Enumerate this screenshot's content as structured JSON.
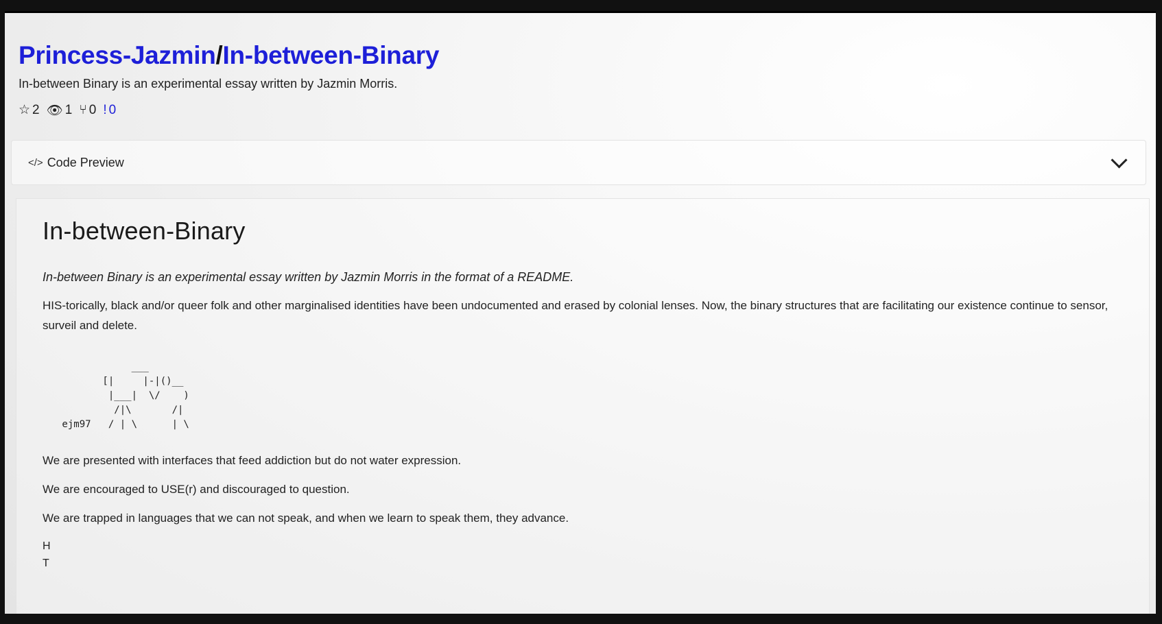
{
  "repo": {
    "owner": "Princess-Jazmin",
    "separator": "/",
    "name": "In-between-Binary",
    "description": "In-between Binary is an experimental essay written by Jazmin Morris."
  },
  "stats": {
    "stars": "2",
    "watchers": "1",
    "forks": "0",
    "issues": "0"
  },
  "code_preview": {
    "icon": "</>",
    "label": "Code Preview"
  },
  "readme": {
    "title": "In-between-Binary",
    "intro": "In-between Binary is an experimental essay written by Jazmin Morris in the format of a README.",
    "paragraph": "HIS-torically, black and/or queer folk and other marginalised identities have been undocumented and erased by colonial lenses. Now, the binary structures that are facilitating our existence continue to sensor, surveil and delete.",
    "ascii_art": "             ___\n        [|     |-|()__\n         |___|  \\/    )\n          /|\\       /|\n ejm97   / | \\      | \\",
    "line1": "We are presented with interfaces that feed addiction but do not water expression.",
    "line2": "We are encouraged to USE(r) and discouraged to question.",
    "line3": "We are trapped in languages that we can not speak, and when we learn to speak them, they advance.",
    "vertical": [
      "H",
      "T"
    ]
  }
}
